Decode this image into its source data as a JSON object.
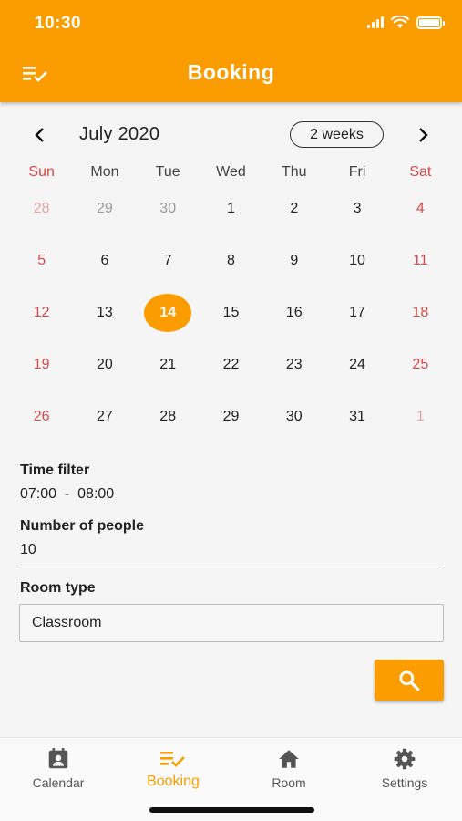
{
  "status_bar": {
    "time": "10:30"
  },
  "app_bar": {
    "title": "Booking"
  },
  "calendar": {
    "month_label": "July 2020",
    "format_button": "2 weeks",
    "weekdays": [
      "Sun",
      "Mon",
      "Tue",
      "Wed",
      "Thu",
      "Fri",
      "Sat"
    ],
    "selected_day": "14",
    "weeks": [
      [
        "28",
        "29",
        "30",
        "1",
        "2",
        "3",
        "4"
      ],
      [
        "5",
        "6",
        "7",
        "8",
        "9",
        "10",
        "11"
      ],
      [
        "12",
        "13",
        "14",
        "15",
        "16",
        "17",
        "18"
      ],
      [
        "19",
        "20",
        "21",
        "22",
        "23",
        "24",
        "25"
      ],
      [
        "26",
        "27",
        "28",
        "29",
        "30",
        "31",
        "1"
      ]
    ]
  },
  "form": {
    "time_filter_label": "Time filter",
    "time_filter_value": "07:00  -  08:00",
    "people_label": "Number of people",
    "people_value": "10",
    "room_type_label": "Room type",
    "room_type_value": "Classroom"
  },
  "bottom_nav": {
    "items": [
      {
        "label": "Calendar",
        "icon": "calendar-icon"
      },
      {
        "label": "Booking",
        "icon": "booking-icon"
      },
      {
        "label": "Room",
        "icon": "home-icon"
      },
      {
        "label": "Settings",
        "icon": "gear-icon"
      }
    ]
  },
  "colors": {
    "accent": "#fb9c00",
    "weekend": "#d84848"
  }
}
